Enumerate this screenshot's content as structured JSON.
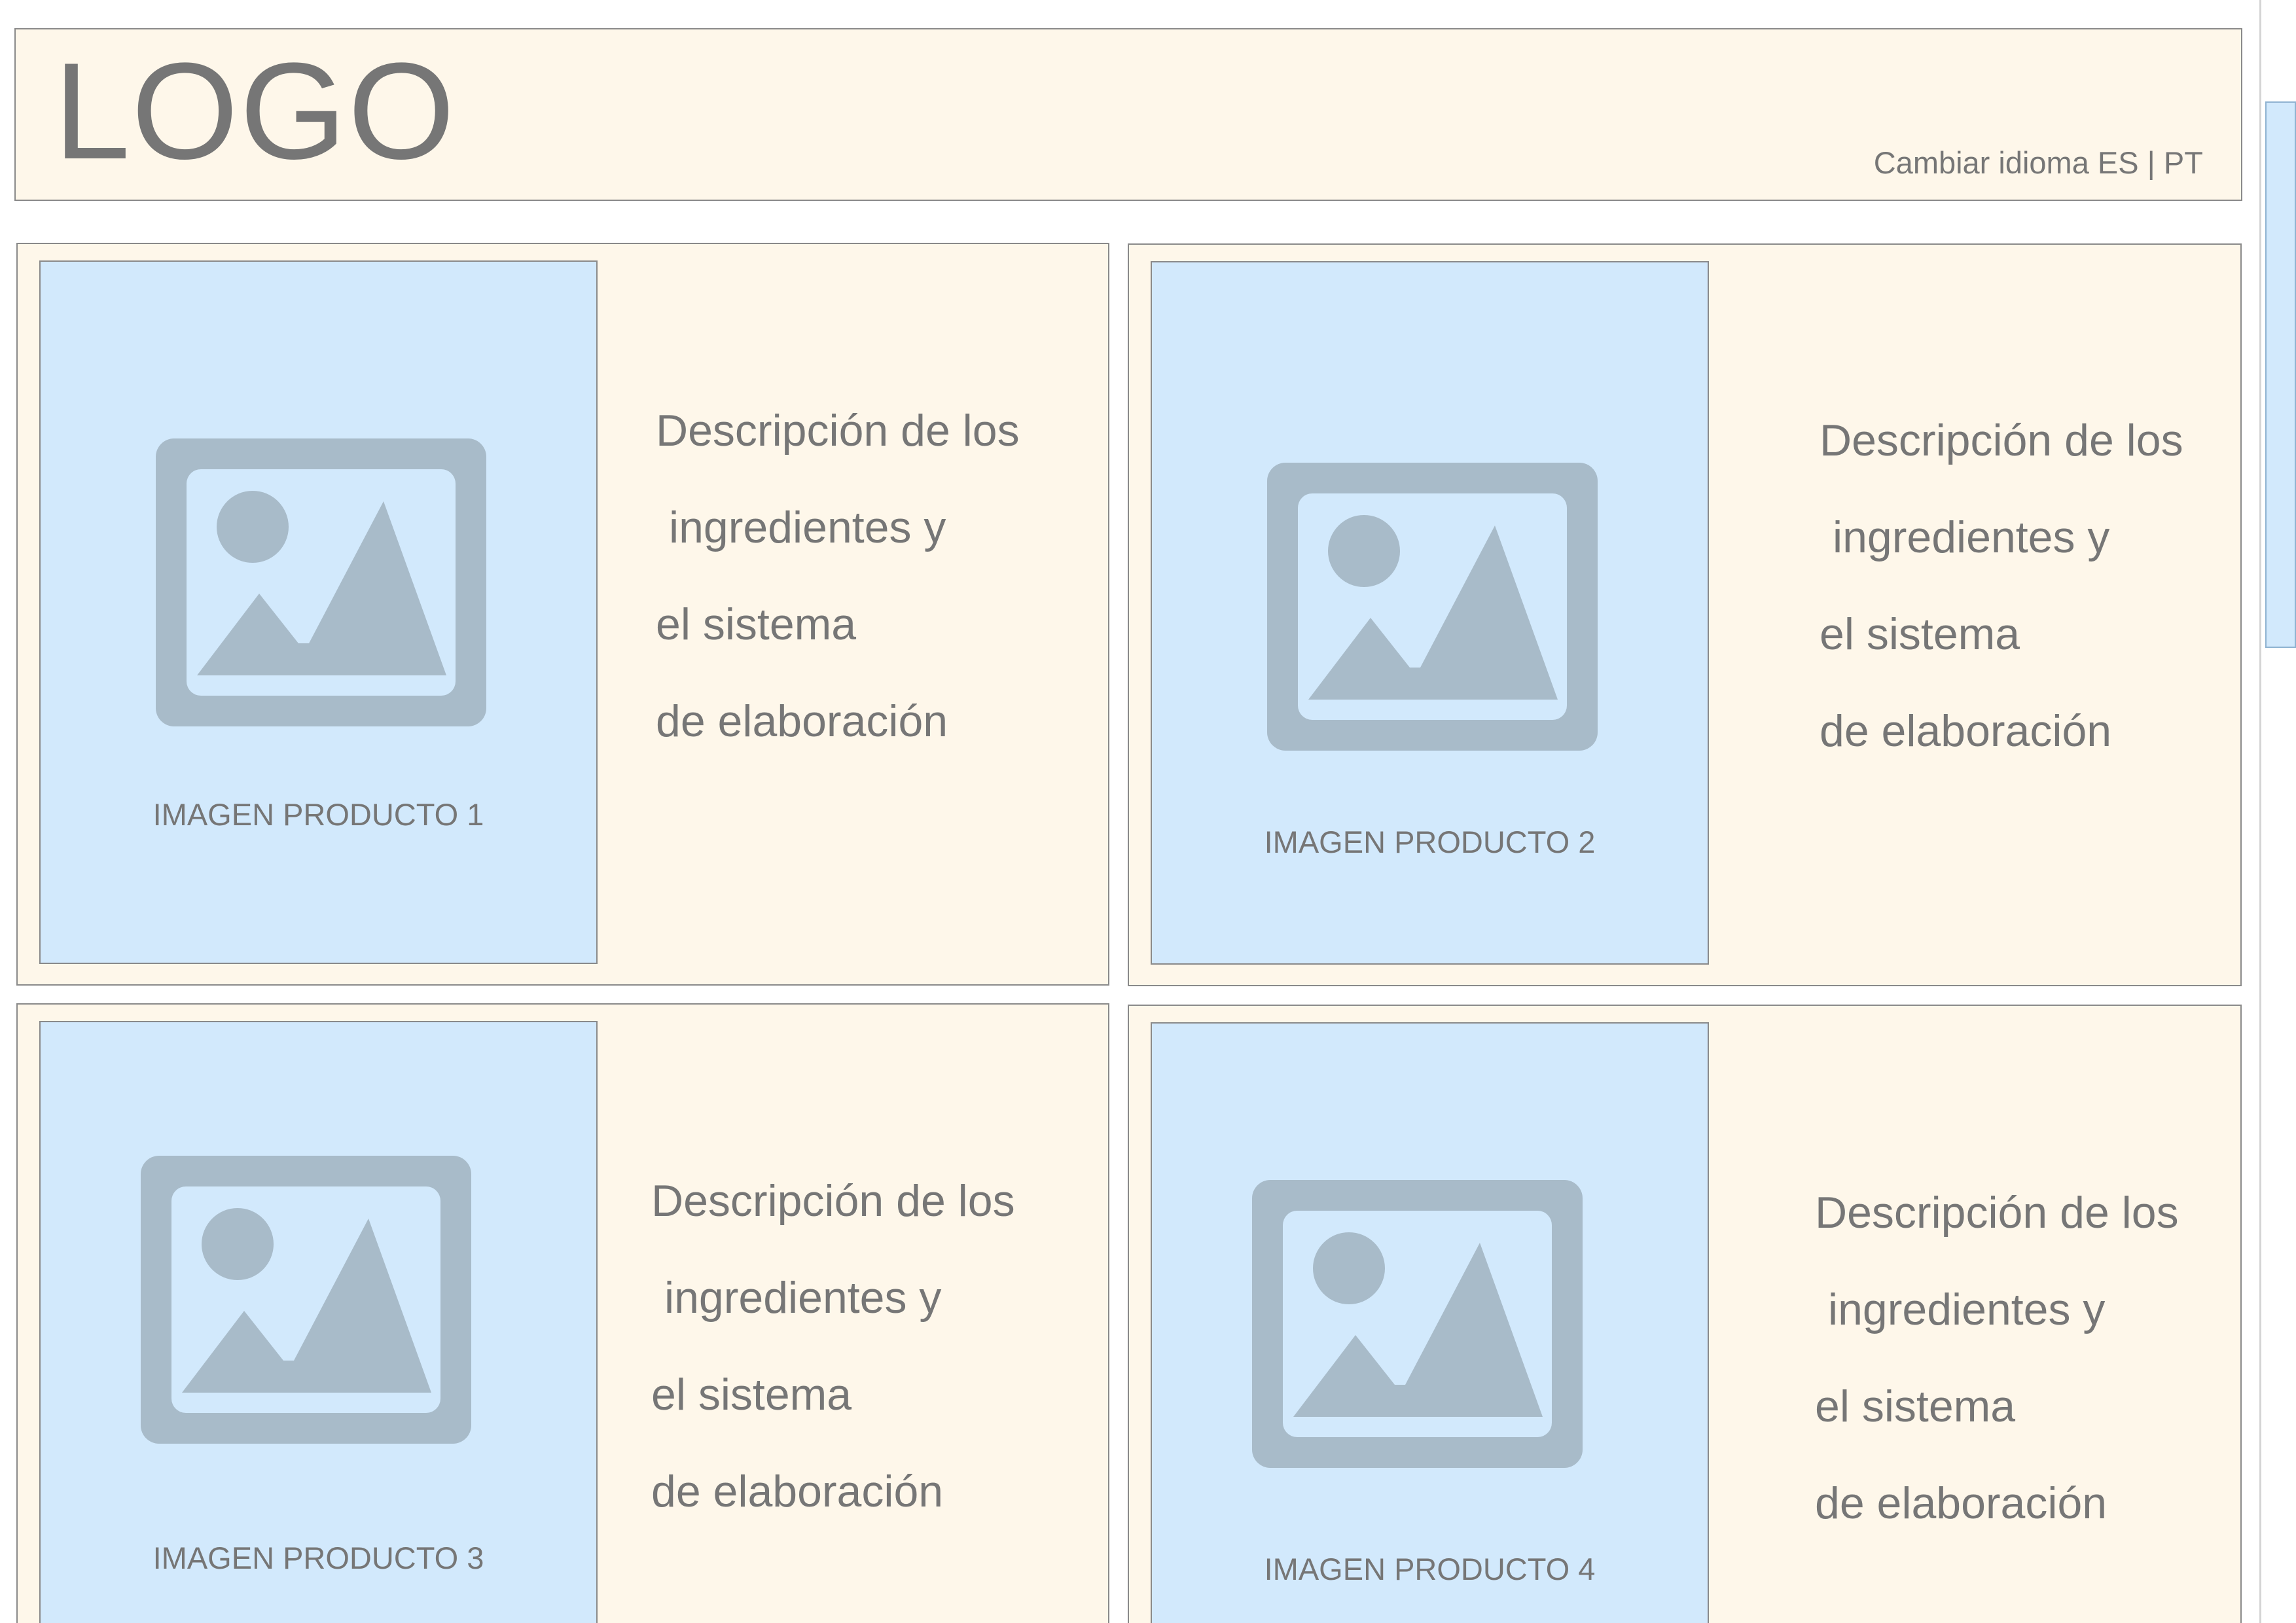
{
  "header": {
    "logo_text": "LOGO",
    "language_switch": "Cambiar idioma ES | PT"
  },
  "products": [
    {
      "image_label": "IMAGEN PRODUCTO 1",
      "description_lines": [
        "Descripción de los",
        "ingredientes y",
        "el sistema",
        "de elaboración"
      ]
    },
    {
      "image_label": "IMAGEN PRODUCTO 2",
      "description_lines": [
        "Descripción de los",
        "ingredientes y",
        "el sistema",
        "de elaboración"
      ]
    },
    {
      "image_label": "IMAGEN PRODUCTO 3",
      "description_lines": [
        "Descripción de los",
        "ingredientes y",
        "el sistema",
        "de elaboración"
      ]
    },
    {
      "image_label": "IMAGEN PRODUCTO 4",
      "description_lines": [
        "Descripción de los",
        "ingredientes y",
        "el sistema",
        "de elaboración"
      ]
    }
  ],
  "icons": {
    "product_image": "image-placeholder-icon"
  },
  "colors": {
    "panel_background": "#fef7ea",
    "image_background": "#d2e9fc",
    "icon_fill": "#a8bbc9",
    "text": "#767676",
    "border": "#8a8a8a"
  }
}
